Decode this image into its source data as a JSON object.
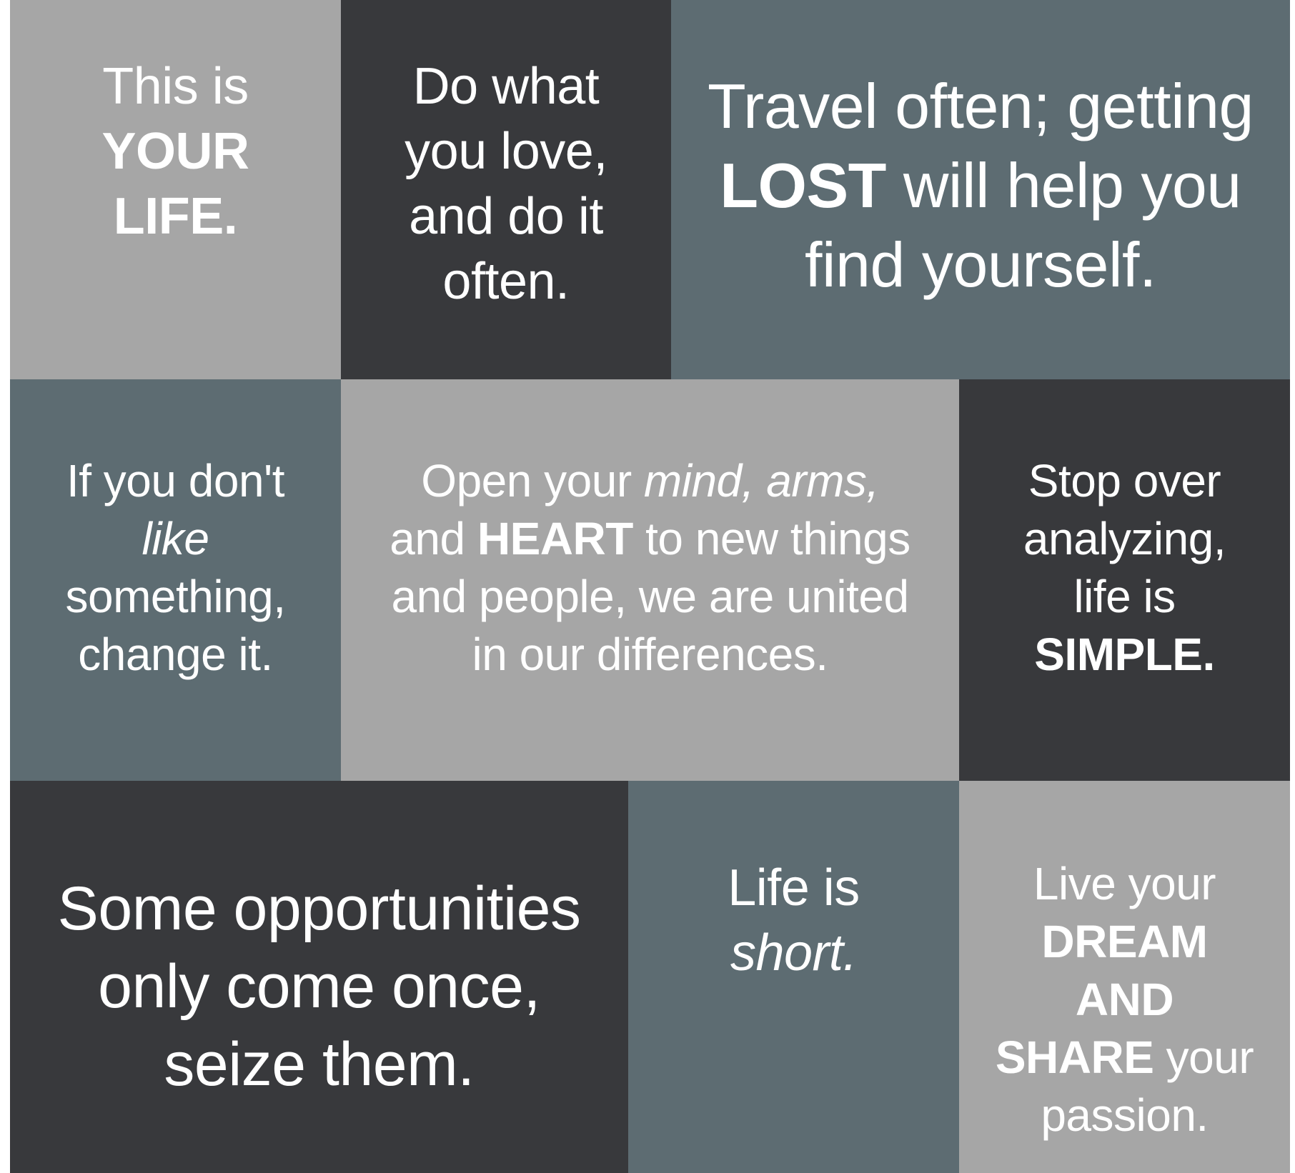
{
  "colors": {
    "light_gray": "#a6a6a6",
    "charcoal": "#38393c",
    "slate": "#5d6c72",
    "text": "#ffffff"
  },
  "tiles": {
    "your_life": {
      "line1": "This is",
      "line2": "YOUR",
      "line3": "LIFE."
    },
    "do_what_you_love": {
      "line1": "Do what",
      "line2": "you love,",
      "line3": "and do it",
      "line4": "often."
    },
    "travel_often": {
      "line1": "Travel often; getting",
      "line2_bold": "LOST",
      "line2_rest": " will help you",
      "line3": "find yourself."
    },
    "change_it": {
      "line1": "If you don't",
      "line2_italic": "like",
      "line3": "something,",
      "line4": "change it."
    },
    "open_your_mind": {
      "line1_start": "Open your ",
      "line1_italic": "mind, arms,",
      "line2_start": "and ",
      "line2_bold": "HEART",
      "line2_rest": " to new things",
      "line3": "and people, we are united",
      "line4": "in our differences."
    },
    "stop_over_analyzing": {
      "line1": "Stop over",
      "line2": "analyzing,",
      "line3": "life is",
      "line4_bold": "SIMPLE."
    },
    "opportunities": {
      "line1": "Some opportunities",
      "line2": "only come once,",
      "line3": "seize them."
    },
    "life_is_short": {
      "line1": "Life is",
      "line2_italic": "short."
    },
    "live_your_dream": {
      "line1": "Live your",
      "line2_bold": "DREAM",
      "line3_bold": "AND",
      "line4_bold": "SHARE",
      "line4_rest": " your",
      "line5": "passion."
    }
  }
}
